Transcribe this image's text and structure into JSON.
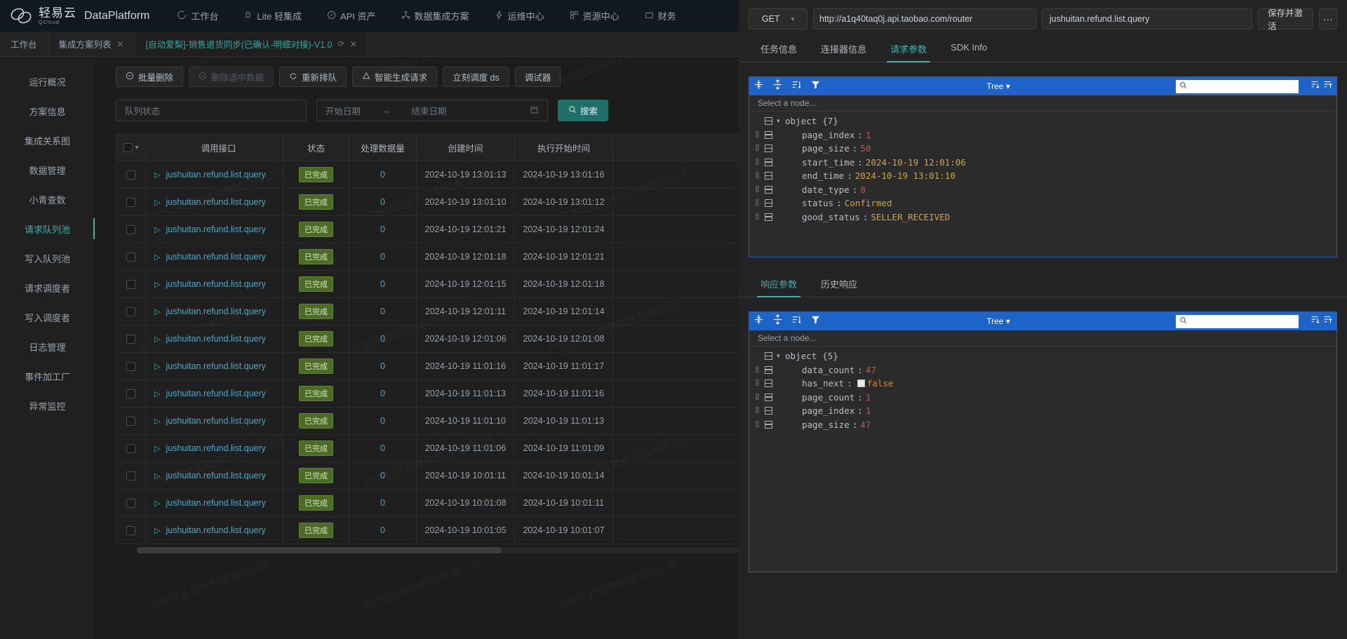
{
  "navbar": {
    "brand_cn": "轻易云",
    "brand_sub": "QCloud",
    "brand_en": "DataPlatform",
    "items": [
      {
        "label": "工作台",
        "icon": "clock-icon"
      },
      {
        "label": "Lite 轻集成",
        "icon": "lamp-icon"
      },
      {
        "label": "API 资产",
        "icon": "compass-icon"
      },
      {
        "label": "数据集成方案",
        "icon": "share-nodes-icon"
      },
      {
        "label": "运维中心",
        "icon": "bolt-icon"
      },
      {
        "label": "资源中心",
        "icon": "grid-icon"
      },
      {
        "label": "财务",
        "icon": "wallet-icon"
      }
    ]
  },
  "tabbar": {
    "tabs": [
      {
        "label": "工作台",
        "closable": false,
        "active": false
      },
      {
        "label": "集成方案列表",
        "closable": true,
        "active": false
      },
      {
        "label": "[自动爱梨]-销售退货同步(已确认-明细对接)-V1.0",
        "closable": true,
        "active": true,
        "reload": true
      }
    ]
  },
  "sidebar": {
    "items": [
      {
        "label": "运行概况",
        "active": false
      },
      {
        "label": "方案信息",
        "active": false
      },
      {
        "label": "集成关系图",
        "active": false
      },
      {
        "label": "数据管理",
        "active": false
      },
      {
        "label": "小青查数",
        "active": false
      },
      {
        "label": "请求队列池",
        "active": true
      },
      {
        "label": "写入队列池",
        "active": false
      },
      {
        "label": "请求调度者",
        "active": false
      },
      {
        "label": "写入调度者",
        "active": false
      },
      {
        "label": "日志管理",
        "active": false
      },
      {
        "label": "事件加工厂",
        "active": false
      },
      {
        "label": "异常监控",
        "active": false
      }
    ]
  },
  "toolbar": {
    "buttons": [
      {
        "label": "批量删除",
        "icon": "minus-circle-icon",
        "disabled": false
      },
      {
        "label": "删除选中数据",
        "icon": "minus-circle-icon",
        "disabled": true
      },
      {
        "label": "重新排队",
        "icon": "refresh-icon",
        "disabled": false
      },
      {
        "label": "智能生成请求",
        "icon": "warning-triangle-icon",
        "disabled": false
      },
      {
        "label": "立刻调度 ds",
        "icon": "none",
        "disabled": false
      },
      {
        "label": "调试器",
        "icon": "none",
        "disabled": false
      }
    ]
  },
  "filters": {
    "status_placeholder": "队列状态",
    "start_date_placeholder": "开始日期",
    "range_sep": "→",
    "end_date_placeholder": "结束日期",
    "calendar_icon": "calendar-icon",
    "search_label": "搜索",
    "search_icon": "search-icon"
  },
  "table": {
    "columns": [
      "调用接口",
      "状态",
      "处理数据量",
      "创建时间",
      "执行开始时间"
    ],
    "rows": [
      {
        "api": "jushuitan.refund.list.query",
        "status": "已完成",
        "count": "0",
        "created": "2024-10-19 13:01:13",
        "started": "2024-10-19 13:01:16"
      },
      {
        "api": "jushuitan.refund.list.query",
        "status": "已完成",
        "count": "0",
        "created": "2024-10-19 13:01:10",
        "started": "2024-10-19 13:01:12"
      },
      {
        "api": "jushuitan.refund.list.query",
        "status": "已完成",
        "count": "0",
        "created": "2024-10-19 12:01:21",
        "started": "2024-10-19 12:01:24"
      },
      {
        "api": "jushuitan.refund.list.query",
        "status": "已完成",
        "count": "0",
        "created": "2024-10-19 12:01:18",
        "started": "2024-10-19 12:01:21"
      },
      {
        "api": "jushuitan.refund.list.query",
        "status": "已完成",
        "count": "0",
        "created": "2024-10-19 12:01:15",
        "started": "2024-10-19 12:01:18"
      },
      {
        "api": "jushuitan.refund.list.query",
        "status": "已完成",
        "count": "0",
        "created": "2024-10-19 12:01:11",
        "started": "2024-10-19 12:01:14"
      },
      {
        "api": "jushuitan.refund.list.query",
        "status": "已完成",
        "count": "0",
        "created": "2024-10-19 12:01:06",
        "started": "2024-10-19 12:01:08"
      },
      {
        "api": "jushuitan.refund.list.query",
        "status": "已完成",
        "count": "0",
        "created": "2024-10-19 11:01:16",
        "started": "2024-10-19 11:01:17"
      },
      {
        "api": "jushuitan.refund.list.query",
        "status": "已完成",
        "count": "0",
        "created": "2024-10-19 11:01:13",
        "started": "2024-10-19 11:01:16"
      },
      {
        "api": "jushuitan.refund.list.query",
        "status": "已完成",
        "count": "0",
        "created": "2024-10-19 11:01:10",
        "started": "2024-10-19 11:01:13"
      },
      {
        "api": "jushuitan.refund.list.query",
        "status": "已完成",
        "count": "0",
        "created": "2024-10-19 11:01:06",
        "started": "2024-10-19 11:01:09"
      },
      {
        "api": "jushuitan.refund.list.query",
        "status": "已完成",
        "count": "0",
        "created": "2024-10-19 10:01:11",
        "started": "2024-10-19 10:01:14"
      },
      {
        "api": "jushuitan.refund.list.query",
        "status": "已完成",
        "count": "0",
        "created": "2024-10-19 10:01:08",
        "started": "2024-10-19 10:01:11"
      },
      {
        "api": "jushuitan.refund.list.query",
        "status": "已完成",
        "count": "0",
        "created": "2024-10-19 10:01:05",
        "started": "2024-10-19 10:01:07"
      }
    ]
  },
  "request_panel": {
    "method": "GET",
    "url": "http://a1q40taq0j.api.taobao.com/router",
    "operation": "jushuitan.refund.list.query",
    "save_label": "保存并激活",
    "more_label": "···",
    "tabs": [
      {
        "label": "任务信息",
        "active": false
      },
      {
        "label": "连接器信息",
        "active": false
      },
      {
        "label": "请求参数",
        "active": true
      },
      {
        "label": "SDK Info",
        "active": false
      }
    ],
    "editor": {
      "mode": "Tree",
      "mode_caret": "▾",
      "hint": "Select a node...",
      "search_icon": "search-icon",
      "root_label": "object",
      "root_count": "{7}",
      "nodes": [
        {
          "key": "page_index",
          "value": "1",
          "kind": "num"
        },
        {
          "key": "page_size",
          "value": "50",
          "kind": "num"
        },
        {
          "key": "start_time",
          "value": "2024-10-19 12:01:06",
          "kind": "str"
        },
        {
          "key": "end_time",
          "value": "2024-10-19 13:01:10",
          "kind": "str"
        },
        {
          "key": "date_type",
          "value": "0",
          "kind": "num"
        },
        {
          "key": "status",
          "value": "Confirmed",
          "kind": "str"
        },
        {
          "key": "good_status",
          "value": "SELLER_RECEIVED",
          "kind": "str"
        }
      ]
    }
  },
  "response_panel": {
    "tabs": [
      {
        "label": "响应参数",
        "active": true
      },
      {
        "label": "历史响应",
        "active": false
      }
    ],
    "editor": {
      "mode": "Tree",
      "mode_caret": "▾",
      "hint": "Select a node...",
      "search_icon": "search-icon",
      "root_label": "object",
      "root_count": "{5}",
      "nodes": [
        {
          "key": "data_count",
          "value": "47",
          "kind": "num"
        },
        {
          "key": "has_next",
          "value": "false",
          "kind": "bool"
        },
        {
          "key": "page_count",
          "value": "1",
          "kind": "num"
        },
        {
          "key": "page_index",
          "value": "1",
          "kind": "num"
        },
        {
          "key": "page_size",
          "value": "47",
          "kind": "num"
        }
      ]
    }
  },
  "watermark": {
    "text": "广东轻亿云软件科技有限公司"
  },
  "colors": {
    "accent_teal": "#3ab3ab",
    "link_blue": "#4aa8c7",
    "editor_blue": "#1e63c8",
    "badge_green": "#4b6b27",
    "search_green": "#1f6f68"
  }
}
